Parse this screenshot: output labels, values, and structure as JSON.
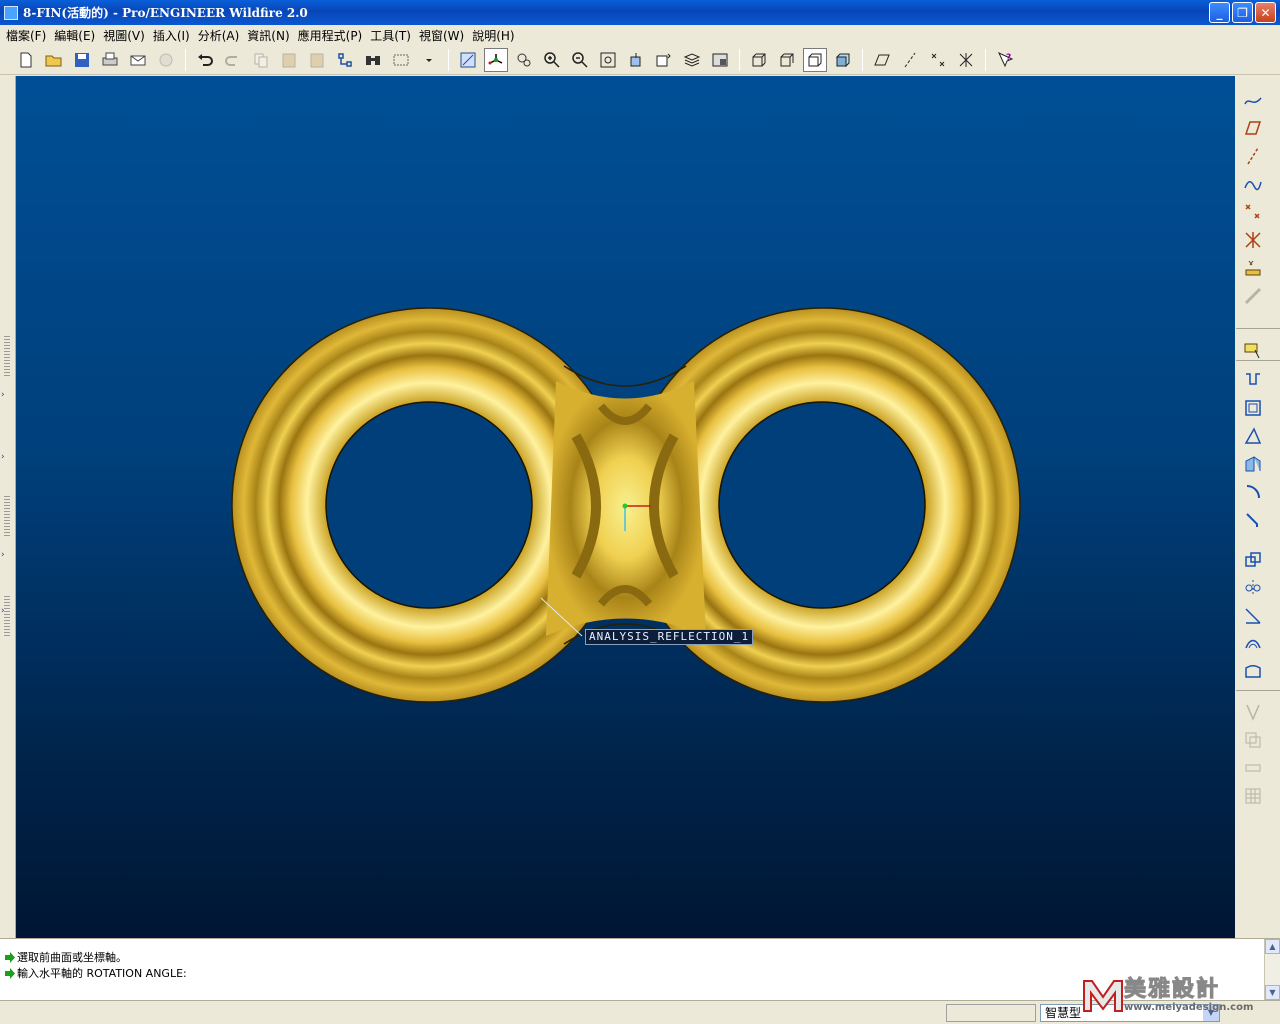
{
  "window": {
    "title": "8-FIN(活動的) - Pro/ENGINEER Wildfire 2.0",
    "minimize": "_",
    "restore": "❐",
    "close": "✕"
  },
  "menu": [
    {
      "label": "檔案(F)"
    },
    {
      "label": "編輯(E)"
    },
    {
      "label": "視圖(V)"
    },
    {
      "label": "插入(I)"
    },
    {
      "label": "分析(A)"
    },
    {
      "label": "資訊(N)"
    },
    {
      "label": "應用程式(P)"
    },
    {
      "label": "工具(T)"
    },
    {
      "label": "視窗(W)"
    },
    {
      "label": "說明(H)"
    }
  ],
  "viewport": {
    "annotation": "ANALYSIS_REFLECTION_1"
  },
  "messages": [
    "選取前曲面或坐標軸。",
    "輸入水平軸的 ROTATION ANGLE:"
  ],
  "status": {
    "filter_value": "智慧型"
  },
  "watermark": {
    "brand": "美雅設計",
    "url": "www.meiyadesign.com"
  },
  "colors": {
    "title_bar": "#0a5fd8",
    "viewport_top": "#004f96",
    "viewport_bottom": "#001633",
    "model_gold": "#d8b030",
    "model_dark_band": "#8a6a10"
  }
}
